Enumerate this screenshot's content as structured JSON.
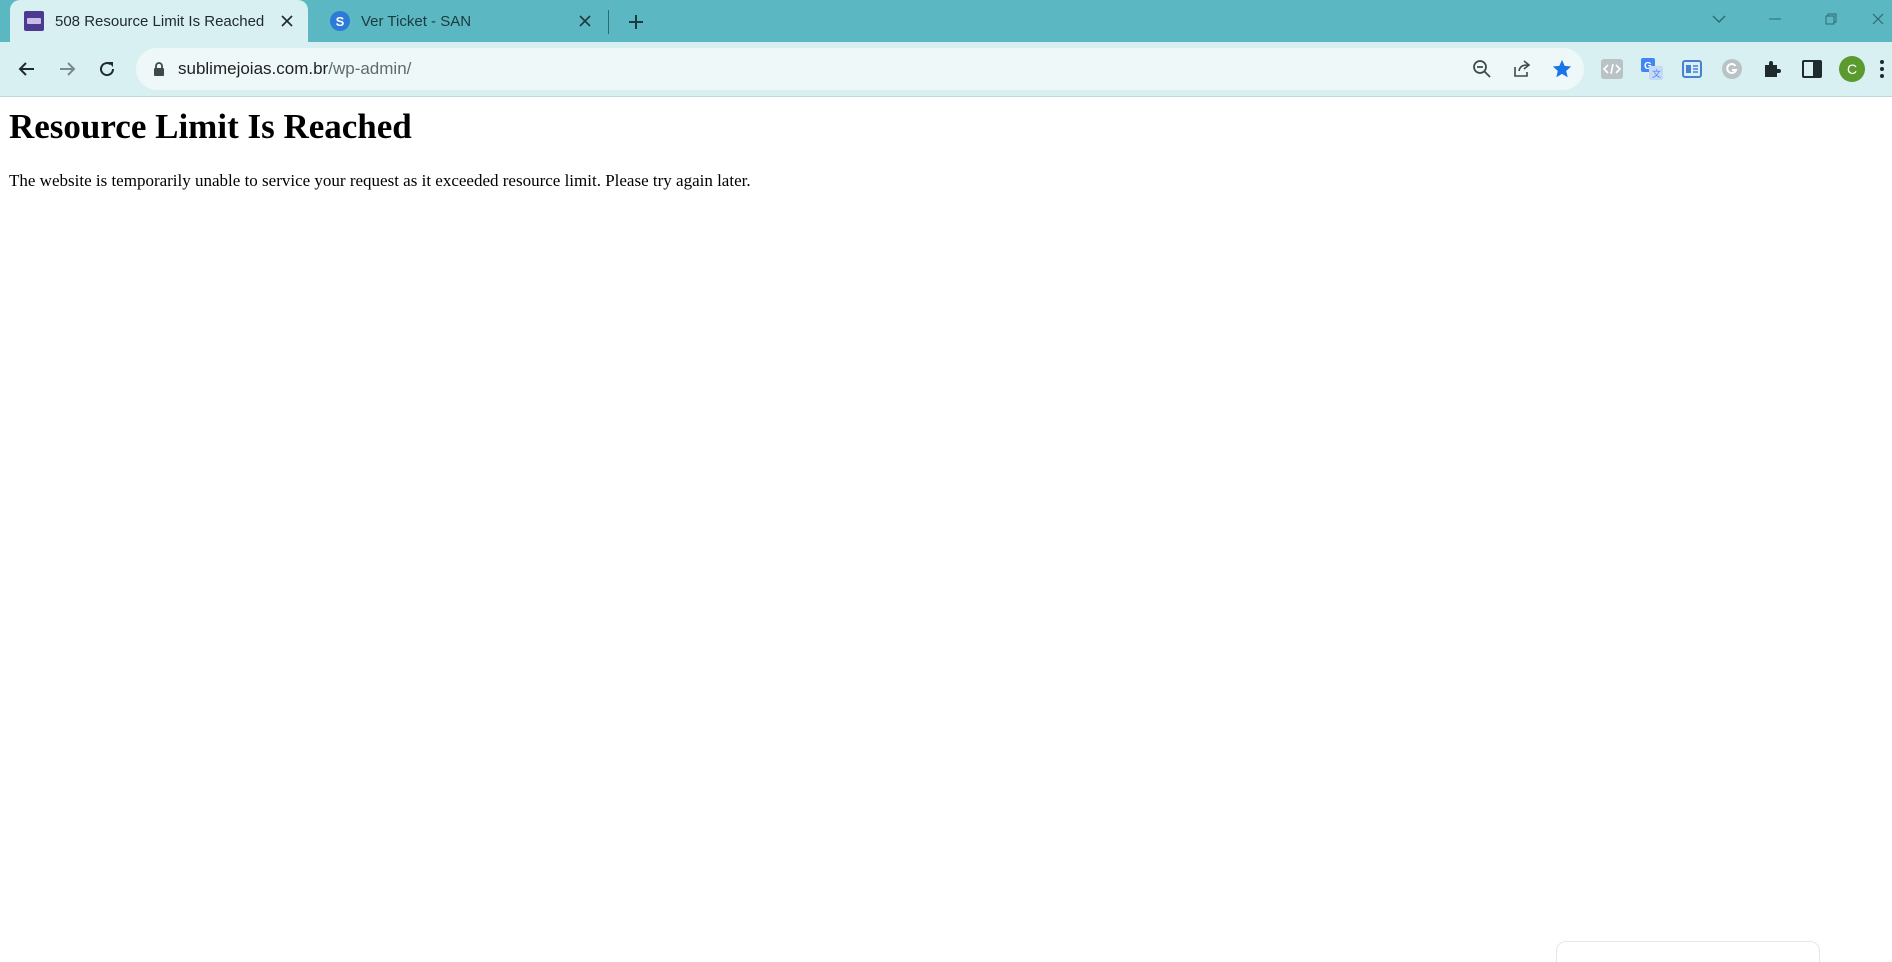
{
  "browser": {
    "tabs": [
      {
        "title": "508 Resource Limit Is Reached",
        "active": true,
        "favicon": "purple-site-favicon"
      },
      {
        "title": "Ver Ticket - SAN",
        "active": false,
        "favicon": "blue-s-favicon"
      }
    ],
    "omnibox": {
      "domain": "sublimejoias.com.br",
      "path": "/wp-admin/"
    },
    "profile_initial": "C",
    "icons": [
      "back-icon",
      "forward-icon",
      "reload-icon",
      "lock-icon",
      "zoom-out-icon",
      "share-icon",
      "bookmark-star-icon",
      "extension-code-icon",
      "extension-translate-icon",
      "extension-tabs-icon",
      "extension-grammarly-icon",
      "extensions-puzzle-icon",
      "side-panel-icon",
      "menu-kebab-icon",
      "tab-search-icon",
      "minimize-icon",
      "restore-icon",
      "close-window-icon"
    ],
    "colors": {
      "tabstrip": "#5bb7c2",
      "toolbar": "#d8f0f2",
      "omnibox": "#eef8f9",
      "bookmark_star": "#1a73e8",
      "avatar": "#5b9a2e"
    }
  },
  "page": {
    "heading": "Resource Limit Is Reached",
    "message": "The website is temporarily unable to service your request as it exceeded resource limit. Please try again later."
  }
}
